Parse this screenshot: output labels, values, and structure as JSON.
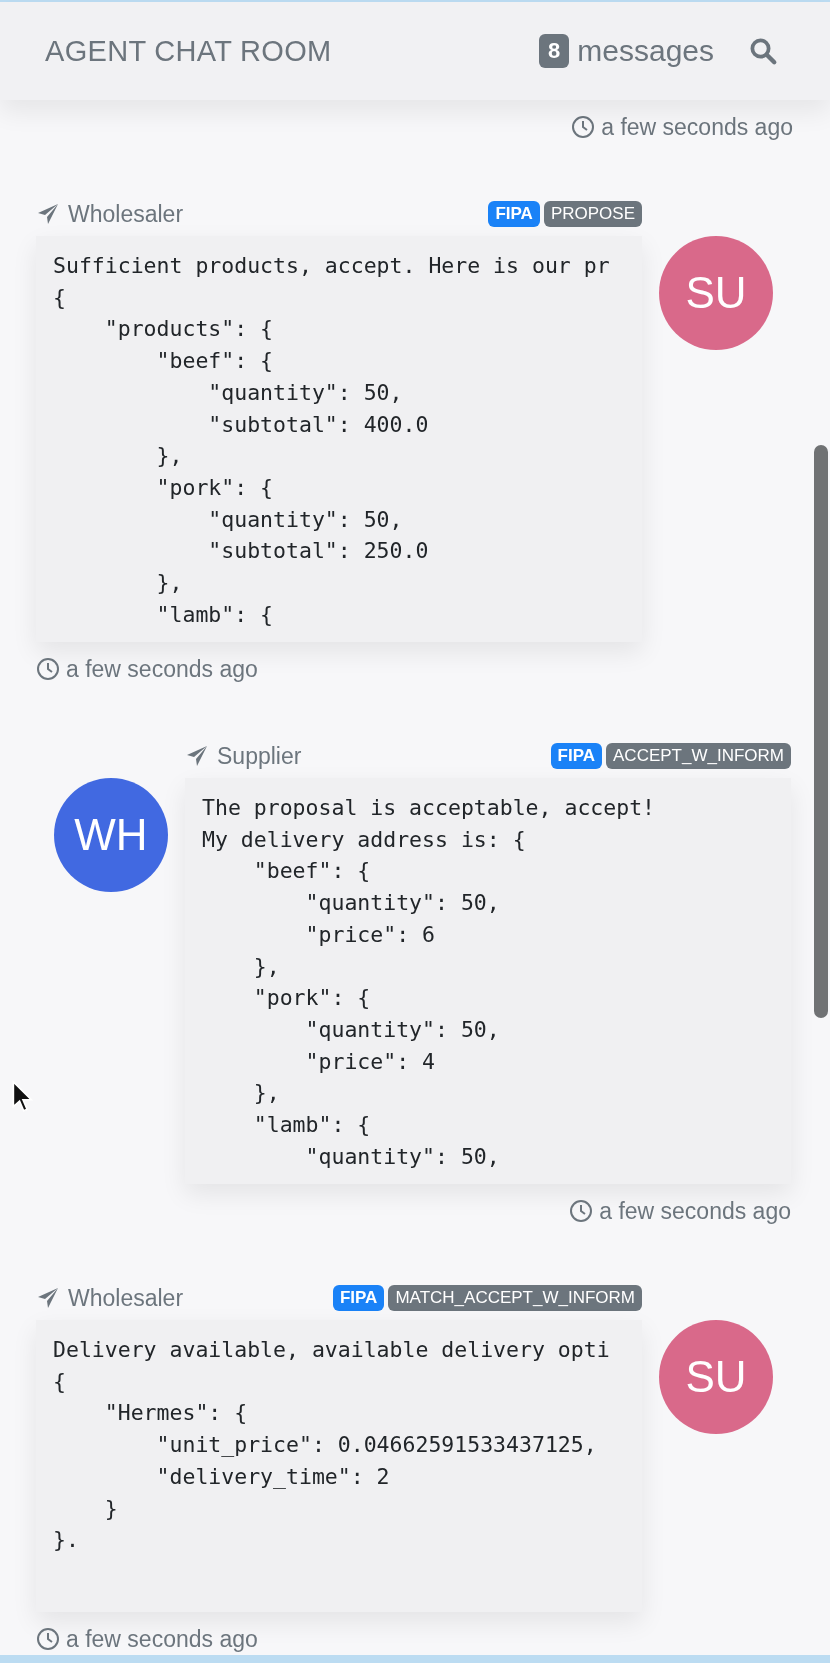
{
  "header": {
    "title": "AGENT CHAT ROOM",
    "message_count": "8",
    "count_label": "messages"
  },
  "top_timestamp": "a few seconds ago",
  "messages": [
    {
      "kind": "left",
      "sender": "Wholesaler",
      "tags": [
        {
          "label": "FIPA",
          "kind": "protocol"
        },
        {
          "label": "PROPOSE",
          "kind": "performative"
        }
      ],
      "avatar": "SU",
      "color": "#d9698a",
      "lines": [
        "Sufficient products, accept. Here is our pr",
        "{",
        "    \"products\": {",
        "        \"beef\": {",
        "            \"quantity\": 50,",
        "            \"subtotal\": 400.0",
        "        },",
        "        \"pork\": {",
        "            \"quantity\": 50,",
        "            \"subtotal\": 250.0",
        "        },",
        "        \"lamb\": {"
      ],
      "clipped": true,
      "timestamp": "a few seconds ago"
    },
    {
      "kind": "right",
      "sender": "Supplier",
      "tags": [
        {
          "label": "FIPA",
          "kind": "protocol"
        },
        {
          "label": "ACCEPT_W_INFORM",
          "kind": "performative"
        }
      ],
      "avatar": "WH",
      "color": "#4169e1",
      "lines": [
        "The proposal is acceptable, accept!",
        "My delivery address is: {",
        "    \"beef\": {",
        "        \"quantity\": 50,",
        "        \"price\": 6",
        "    },",
        "    \"pork\": {",
        "        \"quantity\": 50,",
        "        \"price\": 4",
        "    },",
        "    \"lamb\": {",
        "        \"quantity\": 50,"
      ],
      "clipped": true,
      "timestamp": "a few seconds ago"
    },
    {
      "kind": "left",
      "sender": "Wholesaler",
      "tags": [
        {
          "label": "FIPA",
          "kind": "protocol"
        },
        {
          "label": "MATCH_ACCEPT_W_INFORM",
          "kind": "performative"
        }
      ],
      "avatar": "SU",
      "color": "#d9698a",
      "lines": [
        "Delivery available, available delivery opti",
        "{",
        "    \"Hermes\": {",
        "        \"unit_price\": 0.04662591533437125,",
        "        \"delivery_time\": 2",
        "    }",
        "}."
      ],
      "clipped": false,
      "timestamp": "a few seconds ago"
    }
  ]
}
